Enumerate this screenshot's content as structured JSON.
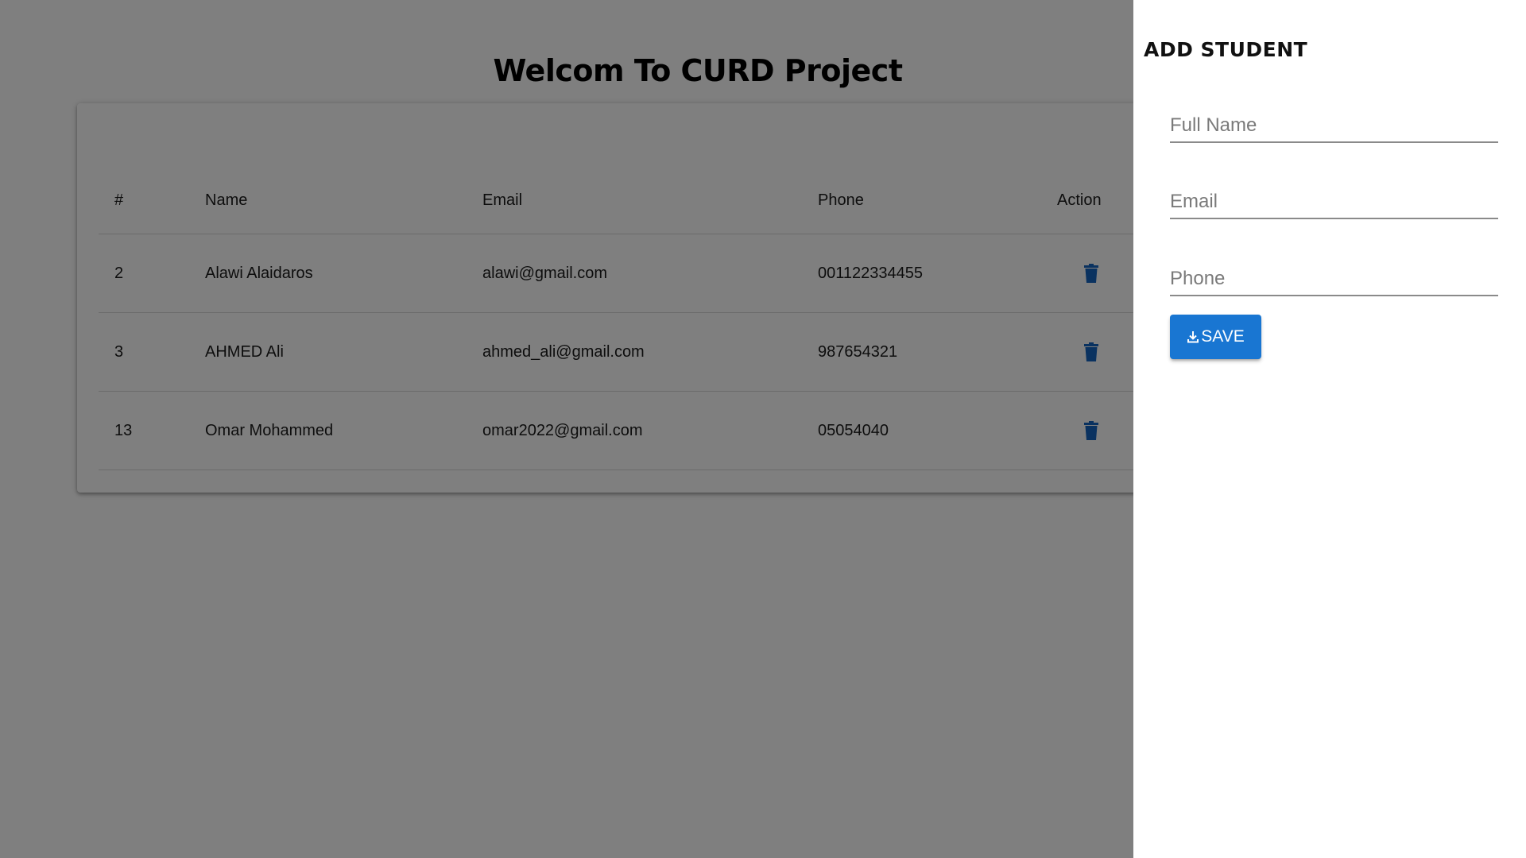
{
  "page": {
    "title": "Welcom To CURD Project"
  },
  "table": {
    "headers": {
      "id": "#",
      "name": "Name",
      "email": "Email",
      "phone": "Phone",
      "action": "Action"
    },
    "rows": [
      {
        "id": "2",
        "name": "Alawi Alaidaros",
        "email": "alawi@gmail.com",
        "phone": "001122334455",
        "action_icon": "trash-icon"
      },
      {
        "id": "3",
        "name": "AHMED Ali",
        "email": "ahmed_ali@gmail.com",
        "phone": "987654321",
        "action_icon": "trash-icon"
      },
      {
        "id": "13",
        "name": "Omar Mohammed",
        "email": "omar2022@gmail.com",
        "phone": "05054040",
        "action_icon": "trash-icon"
      }
    ]
  },
  "drawer": {
    "title": "ADD STUDENT",
    "fields": {
      "full_name": {
        "placeholder": "Full Name",
        "value": ""
      },
      "email": {
        "placeholder": "Email",
        "value": ""
      },
      "phone": {
        "placeholder": "Phone",
        "value": ""
      }
    },
    "save_button": {
      "label": "SAVE",
      "icon": "download-icon"
    }
  },
  "colors": {
    "primary": "#1976d2",
    "trash_icon": "#1565c0",
    "backdrop": "rgba(0,0,0,0.5)"
  }
}
